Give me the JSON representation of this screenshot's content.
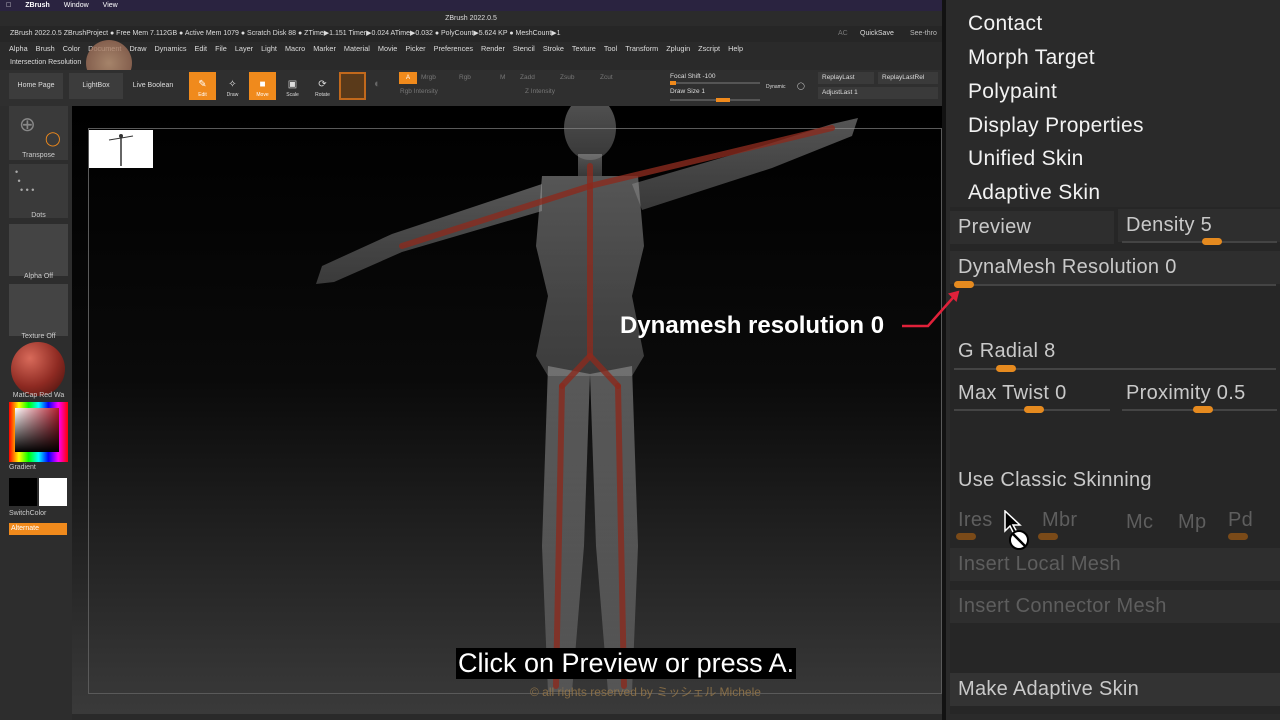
{
  "macbar": {
    "app": "ZBrush",
    "items": [
      "Window",
      "View"
    ]
  },
  "title": "ZBrush 2022.0.5",
  "infobar": {
    "text": "ZBrush 2022.0.5 ZBrushProject     ● Free Mem 7.112GB ● Active Mem 1079 ● Scratch Disk 88 ●  ZTime▶1.151 Timer▶0.024 ATime▶0.032 ● PolyCount▶5.624 KP ● MeshCount▶1",
    "ac": "AC",
    "quicksave": "QuickSave",
    "seethrough": "See-thro"
  },
  "menu": [
    "Alpha",
    "Brush",
    "Color",
    "Document",
    "Draw",
    "Dynamics",
    "Edit",
    "File",
    "Layer",
    "Light",
    "Macro",
    "Marker",
    "Material",
    "Movie",
    "Picker",
    "Preferences",
    "Render",
    "Stencil",
    "Stroke",
    "Texture",
    "Tool",
    "Transform",
    "Zplugin",
    "Zscript",
    "Help"
  ],
  "ir_label": "Intersection Resolution",
  "toolbar": {
    "home": "Home Page",
    "lightbox": "LightBox",
    "liveboolean": "Live Boolean",
    "edit": "Edit",
    "draw": "Draw",
    "move": "Move",
    "scale": "Scale",
    "rotate": "Rotate",
    "a": "A",
    "mrgb": "Mrgb",
    "rgb": "Rgb",
    "m": "M",
    "zadd": "Zadd",
    "zsub": "Zsub",
    "zcut": "Zcut",
    "rgbintensity": "Rgb Intensity",
    "zintensity": "Z Intensity",
    "focalshift": "Focal Shift -100",
    "drawsize": "Draw Size 1",
    "dynamic": "Dynamic",
    "replaylast": "ReplayLast",
    "replaylastrel": "ReplayLastRel",
    "adjustlast": "AdjustLast 1"
  },
  "left": {
    "transpose": "Transpose",
    "dots": "Dots",
    "alpha": "Alpha Off",
    "texture": "Texture Off",
    "matcap": "MatCap Red Wa",
    "gradient": "Gradient",
    "switchcolor": "SwitchColor",
    "alternate": "Alternate"
  },
  "right": {
    "menu": [
      "Contact",
      "Morph Target",
      "Polypaint",
      "Display Properties",
      "Unified Skin",
      "Adaptive Skin"
    ],
    "preview": "Preview",
    "density": "Density 5",
    "dynamesh": "DynaMesh Resolution 0",
    "gradial": "G Radial 8",
    "maxtwist": "Max Twist 0",
    "proximity": "Proximity 0.5",
    "classic": "Use Classic Skinning",
    "ires": "Ires",
    "mbr": "Mbr",
    "mc": "Mc",
    "mp": "Mp",
    "pd": "Pd",
    "insertlocal": "Insert Local Mesh",
    "insertconnector": "Insert Connector Mesh",
    "make": "Make Adaptive Skin"
  },
  "annotation": "Dynamesh resolution 0",
  "caption": "Click on Preview or press A.",
  "watermark": "© all rights reserved by ミッシェル Michele",
  "colors": {
    "accent": "#f08a1c",
    "panel": "#2a2a2a",
    "annotation_arrow": "#e0213a"
  }
}
